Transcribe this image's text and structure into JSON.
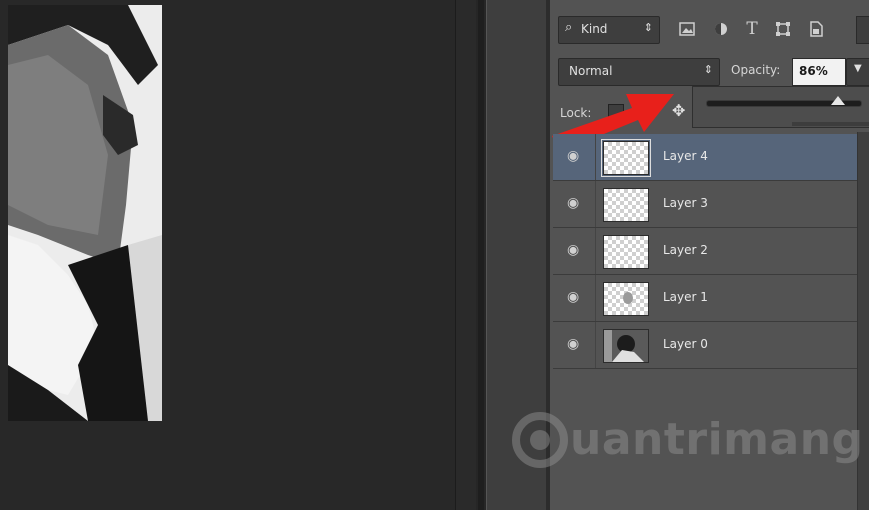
{
  "layers_panel": {
    "filter": {
      "label": "Kind",
      "arrows": "⇕"
    },
    "blend_mode": {
      "value": "Normal"
    },
    "opacity": {
      "label": "Opacity:",
      "value": "86%"
    },
    "lock": {
      "label": "Lock:"
    },
    "opacity_slider": {
      "value_percent": 86
    },
    "layers": [
      {
        "name": "Layer 4",
        "selected": true
      },
      {
        "name": "Layer 3",
        "selected": false
      },
      {
        "name": "Layer 2",
        "selected": false
      },
      {
        "name": "Layer 1",
        "selected": false
      },
      {
        "name": "Layer 0",
        "selected": false
      }
    ]
  },
  "watermark": {
    "text": "uantrimang"
  },
  "colors": {
    "panel_bg": "#535353",
    "selected_row": "#56657a",
    "annotation_arrow": "#e8201b"
  },
  "icons": [
    "search-icon",
    "image-filter-icon",
    "adjustment-filter-icon",
    "type-filter-icon",
    "shape-filter-icon",
    "smart-object-filter-icon",
    "eye-icon",
    "move-icon"
  ]
}
